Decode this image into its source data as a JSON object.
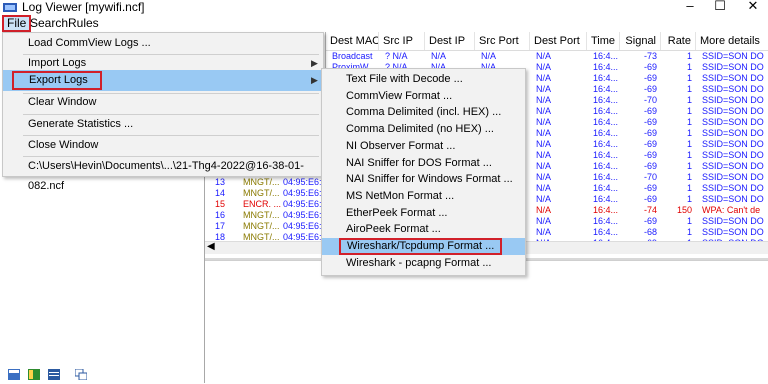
{
  "window": {
    "title": "Log Viewer [mywifi.ncf]",
    "minimize_glyph": "–",
    "maximize_glyph": "☐",
    "close_glyph": "✕"
  },
  "menubar": {
    "file": "File",
    "search": "Search",
    "rules": "Rules"
  },
  "file_menu": {
    "load_commview": "Load CommView Logs ...",
    "import_logs": "Import Logs",
    "export_logs": "Export Logs",
    "clear_window": "Clear Window",
    "generate_statistics": "Generate Statistics ...",
    "close_window": "Close Window",
    "recent_file": "C:\\Users\\Hevin\\Documents\\...\\21-Thg4-2022@16-38-01-082.ncf"
  },
  "export_submenu": [
    "Text File with Decode ...",
    "CommView Format ...",
    "Comma Delimited (incl. HEX) ...",
    "Comma Delimited (no HEX) ...",
    "NI Observer Format ...",
    "NAI Sniffer for DOS Format ...",
    "NAI Sniffer for Windows Format ...",
    "MS NetMon Format ...",
    "EtherPeek Format ...",
    "AiroPeek Format ...",
    "Wireshark/Tcpdump Format ...",
    "Wireshark - pcapng Format ..."
  ],
  "log_table": {
    "columns": [
      "Dest MAC",
      "Src IP",
      "Dest IP",
      "Src Port",
      "Dest Port",
      "Time",
      "Signal",
      "Rate",
      "More details"
    ],
    "rows": [
      {
        "dest_mac": "Broadcast",
        "src_ip": "? N/A",
        "dest_ip": "N/A",
        "src_port": "N/A",
        "dest_port": "N/A",
        "time": "16:4...",
        "signal": "-73",
        "rate": "1",
        "details": "SSID=SON DO"
      },
      {
        "dest_mac": "ProximW...",
        "src_ip": "? N/A",
        "dest_ip": "N/A",
        "src_port": "N/A",
        "dest_port": "N/A",
        "time": "16:4...",
        "signal": "-69",
        "rate": "1",
        "details": "SSID=SON DO"
      },
      {
        "dest_mac": "",
        "src_ip": "",
        "dest_ip": "",
        "src_port": "",
        "dest_port": "N/A",
        "time": "16:4...",
        "signal": "-69",
        "rate": "1",
        "details": "SSID=SON DO"
      },
      {
        "dest_mac": "",
        "src_ip": "",
        "dest_ip": "",
        "src_port": "",
        "dest_port": "N/A",
        "time": "16:4...",
        "signal": "-69",
        "rate": "1",
        "details": "SSID=SON DO"
      },
      {
        "dest_mac": "",
        "src_ip": "",
        "dest_ip": "",
        "src_port": "",
        "dest_port": "N/A",
        "time": "16:4...",
        "signal": "-70",
        "rate": "1",
        "details": "SSID=SON DO"
      },
      {
        "dest_mac": "",
        "src_ip": "",
        "dest_ip": "",
        "src_port": "",
        "dest_port": "N/A",
        "time": "16:4...",
        "signal": "-69",
        "rate": "1",
        "details": "SSID=SON DO"
      },
      {
        "dest_mac": "",
        "src_ip": "",
        "dest_ip": "",
        "src_port": "",
        "dest_port": "N/A",
        "time": "16:4...",
        "signal": "-69",
        "rate": "1",
        "details": "SSID=SON DO"
      },
      {
        "dest_mac": "",
        "src_ip": "",
        "dest_ip": "",
        "src_port": "",
        "dest_port": "N/A",
        "time": "16:4...",
        "signal": "-69",
        "rate": "1",
        "details": "SSID=SON DO"
      },
      {
        "dest_mac": "",
        "src_ip": "",
        "dest_ip": "",
        "src_port": "",
        "dest_port": "N/A",
        "time": "16:4...",
        "signal": "-69",
        "rate": "1",
        "details": "SSID=SON DO"
      },
      {
        "dest_mac": "",
        "src_ip": "",
        "dest_ip": "",
        "src_port": "",
        "dest_port": "N/A",
        "time": "16:4...",
        "signal": "-69",
        "rate": "1",
        "details": "SSID=SON DO"
      },
      {
        "dest_mac": "",
        "src_ip": "",
        "dest_ip": "",
        "src_port": "",
        "dest_port": "N/A",
        "time": "16:4...",
        "signal": "-69",
        "rate": "1",
        "details": "SSID=SON DO"
      },
      {
        "dest_mac": "",
        "src_ip": "",
        "dest_ip": "",
        "src_port": "",
        "dest_port": "N/A",
        "time": "16:4...",
        "signal": "-70",
        "rate": "1",
        "details": "SSID=SON DO"
      },
      {
        "dest_mac": "",
        "src_ip": "",
        "dest_ip": "",
        "src_port": "",
        "dest_port": "N/A",
        "time": "16:4...",
        "signal": "-69",
        "rate": "1",
        "details": "SSID=SON DO"
      },
      {
        "dest_mac": "",
        "src_ip": "",
        "dest_ip": "",
        "src_port": "",
        "dest_port": "N/A",
        "time": "16:4...",
        "signal": "-69",
        "rate": "1",
        "details": "SSID=SON DO"
      },
      {
        "dest_mac": "",
        "src_ip": "",
        "dest_ip": "",
        "src_port": "",
        "dest_port": "N/A",
        "time": "16:4...",
        "signal": "-74",
        "rate": "150",
        "details": "WPA: Can't de"
      },
      {
        "dest_mac": "",
        "src_ip": "",
        "dest_ip": "",
        "src_port": "",
        "dest_port": "N/A",
        "time": "16:4...",
        "signal": "-69",
        "rate": "1",
        "details": "SSID=SON DO"
      },
      {
        "dest_mac": "",
        "src_ip": "",
        "dest_ip": "",
        "src_port": "",
        "dest_port": "N/A",
        "time": "16:4...",
        "signal": "-68",
        "rate": "1",
        "details": "SSID=SON DO"
      },
      {
        "dest_mac": "",
        "src_ip": "",
        "dest_ip": "",
        "src_port": "",
        "dest_port": "N/A",
        "time": "16:4...",
        "signal": "-69",
        "rate": "1",
        "details": "SSID=SON DO"
      }
    ]
  },
  "left_rows": [
    {
      "no": "13",
      "proto": "MNGT/...",
      "mac": "04:95:E6:"
    },
    {
      "no": "14",
      "proto": "MNGT/...",
      "mac": "04:95:E6:"
    },
    {
      "no": "15",
      "proto": "ENCR. ...",
      "mac": "04:95:E6:"
    },
    {
      "no": "16",
      "proto": "MNGT/...",
      "mac": "04:95:E6:"
    },
    {
      "no": "17",
      "proto": "MNGT/...",
      "mac": "04:95:E6:"
    },
    {
      "no": "18",
      "proto": "MNGT/...",
      "mac": "04:95:E6:"
    }
  ],
  "colors": {
    "highlight": "#99c9f3",
    "red_box": "#d1202a",
    "link_blue": "#1a1aff",
    "olive": "#8a7a00",
    "encr_red": "#e00000"
  }
}
